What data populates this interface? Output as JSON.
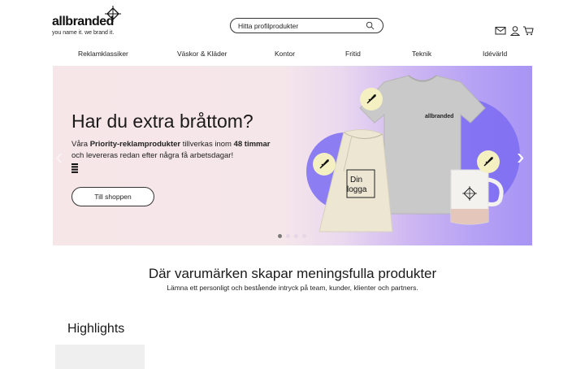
{
  "header": {
    "logo_text": "allbranded",
    "logo_tagline": "you name it. we brand it.",
    "search_placeholder": "Hitta profilprodukter"
  },
  "nav": {
    "items": [
      "Reklamklassiker",
      "Väskor & Kläder",
      "Kontor",
      "Fritid",
      "Teknik",
      "Idévärld"
    ]
  },
  "hero": {
    "title": "Har du extra bråttom?",
    "body_prefix": "Våra ",
    "body_bold": "Priority-reklamprodukter",
    "body_mid": " tillverkas inom ",
    "body_bold2": "48 timmar",
    "body_suffix": " och levereras redan efter några få arbetsdagar!",
    "button_label": "Till shoppen",
    "shirt_print": "allbranded",
    "bag_print_line1": "Din",
    "bag_print_line2": "logga",
    "slides_total": 4,
    "slide_active": 1
  },
  "tagline": {
    "title": "Där varumärken skapar meningsfulla produkter",
    "subtitle": "Lämna ett personligt och bestående intryck på team, kunder, klienter och partners."
  },
  "highlights": {
    "title": "Highlights"
  },
  "colors": {
    "accent_purple": "#7b6cf2",
    "badge_yellow": "#f4f0c2"
  }
}
